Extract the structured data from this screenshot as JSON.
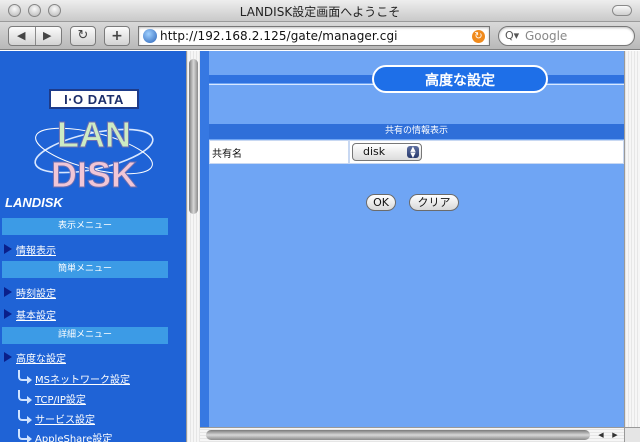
{
  "window": {
    "title": "LANDISK設定画面へようこそ"
  },
  "toolbar": {
    "back_glyph": "◀",
    "forward_glyph": "▶",
    "reload_glyph": "↻",
    "add_glyph": "+",
    "address": "http://192.168.2.125/gate/manager.cgi",
    "search_placeholder": "Google",
    "search_glyph": "Q▾",
    "refresh_glyph": "↻"
  },
  "sidebar": {
    "logo_io": "I·O DATA",
    "logo_lan": "LAN",
    "logo_disk": "DISK",
    "brand": "LANDISK",
    "sections": [
      {
        "label": "表示メニュー",
        "items": [
          "情報表示"
        ]
      },
      {
        "label": "簡単メニュー",
        "items": [
          "時刻設定",
          "基本設定"
        ]
      },
      {
        "label": "詳細メニュー",
        "items": [
          "高度な設定"
        ]
      }
    ],
    "subitems": [
      "MSネットワーク設定",
      "TCP/IP設定",
      "サービス設定",
      "AppleShare設定"
    ]
  },
  "main": {
    "heading": "高度な設定",
    "section_header": "共有の情報表示",
    "row_label": "共有名",
    "share_select": {
      "value": "disk"
    },
    "ok_label": "OK",
    "clear_label": "クリア"
  },
  "colors": {
    "sidebar_bg": "#1f63d6",
    "menu_header": "#3c9be6",
    "content_bg": "#6fa5f4",
    "heading_pill": "#1e6fe8"
  }
}
